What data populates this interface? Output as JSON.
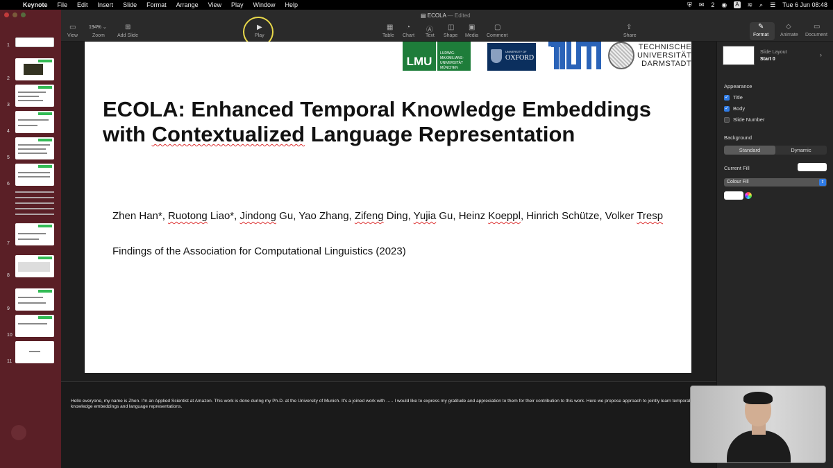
{
  "menubar": {
    "app": "Keynote",
    "items": [
      "File",
      "Edit",
      "Insert",
      "Slide",
      "Format",
      "Arrange",
      "View",
      "Play",
      "Window",
      "Help"
    ],
    "right": {
      "count": "2",
      "input": "A",
      "datetime": "Tue 6 Jun  08:48"
    }
  },
  "window": {
    "doc_title": "ECOLA",
    "doc_status": "— Edited"
  },
  "toolbar": {
    "view": "View",
    "zoom_label": "Zoom",
    "zoom_value": "194%",
    "add_slide": "Add Slide",
    "play": "Play",
    "table": "Table",
    "chart": "Chart",
    "text": "Text",
    "shape": "Shape",
    "media": "Media",
    "comment": "Comment",
    "share": "Share",
    "format": "Format",
    "animate": "Animate",
    "document": "Document"
  },
  "navigator": {
    "slide_numbers": [
      "1",
      "2",
      "3",
      "4",
      "5",
      "6",
      "7",
      "8",
      "9",
      "10",
      "11"
    ]
  },
  "slide": {
    "logos": {
      "lmu": "LMU",
      "lmu_text": "LUDWIG-MAXIMILIANS-UNIVERSITÄT MÜNCHEN",
      "oxford_small": "UNIVERSITY OF",
      "oxford_big": "OXFORD",
      "tud_line1": "TECHNISCHE",
      "tud_line2": "UNIVERSITÄT",
      "tud_line3": "DARMSTADT"
    },
    "title_line1": "ECOLA: Enhanced Temporal Knowledge Embeddings",
    "title_line2_a": "with ",
    "title_line2_b": "Contextualized",
    "title_line2_c": " Language Representation",
    "authors": {
      "a1": "Zhen Han*, ",
      "a2": "Ruotong",
      "a3": " Liao*, ",
      "a4": "Jindong",
      "a5": " Gu, Yao Zhang, ",
      "a6": "Zifeng",
      "a7": " Ding, ",
      "a8": "Yujia",
      "a9": " Gu, Heinz ",
      "a10": "Koeppl",
      "a11": ", Hinrich Schütze, Volker ",
      "a12": "Tresp"
    },
    "venue": "Findings of the Association for Computational Linguistics (2023)"
  },
  "inspector": {
    "layout_label": "Slide Layout",
    "layout_value": "Start 0",
    "appearance": "Appearance",
    "title_chk": "Title",
    "body_chk": "Body",
    "slide_number_chk": "Slide Number",
    "checks": {
      "title": true,
      "body": true,
      "slide_number": false
    },
    "background": "Background",
    "seg_standard": "Standard",
    "seg_dynamic": "Dynamic",
    "current_fill": "Current Fill",
    "fill_type": "Colour Fill"
  },
  "notes": {
    "text": "Hello everyone, my name is Zhen. I'm an Applied Scientist at Amazon. This work is done during my Ph.D. at the University of Munich. It's a joined work with ….. I would like to express my gratitude and appreciation to them for their contribution to this work. Here we propose approach to jointly learn temporal knowledge embeddings and language representations."
  },
  "colors": {
    "sidebar": "#5a1f26",
    "accent": "#2f7be5",
    "lmu_green": "#1e7d3a",
    "oxford_blue": "#0b2f5e",
    "tum_blue": "#2a63b8"
  }
}
